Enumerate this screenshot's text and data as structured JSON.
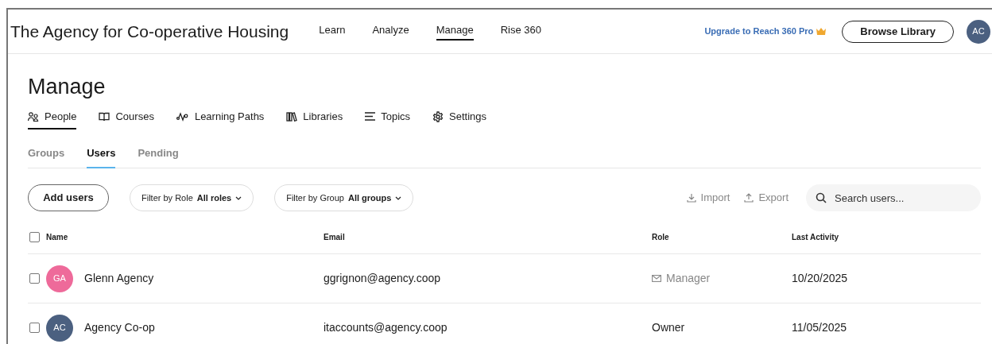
{
  "header": {
    "org_name": "The Agency for Co-operative Housing",
    "nav": [
      {
        "label": "Learn",
        "selected": false
      },
      {
        "label": "Analyze",
        "selected": false
      },
      {
        "label": "Manage",
        "selected": true
      },
      {
        "label": "Rise 360",
        "selected": false
      }
    ],
    "upgrade_link": "Upgrade to Reach 360 Pro",
    "browse_button": "Browse Library",
    "avatar": "AC"
  },
  "page_title": "Manage",
  "section_tabs": [
    {
      "label": "People",
      "kind": "people",
      "selected": true
    },
    {
      "label": "Courses",
      "kind": "courses",
      "selected": false
    },
    {
      "label": "Learning Paths",
      "kind": "paths",
      "selected": false
    },
    {
      "label": "Libraries",
      "kind": "libraries",
      "selected": false
    },
    {
      "label": "Topics",
      "kind": "topics",
      "selected": false
    },
    {
      "label": "Settings",
      "kind": "settings",
      "selected": false
    }
  ],
  "sub_tabs": [
    {
      "label": "Groups",
      "selected": false
    },
    {
      "label": "Users",
      "selected": true
    },
    {
      "label": "Pending",
      "selected": false
    }
  ],
  "toolbar": {
    "add_button": "Add users",
    "filters": [
      {
        "label": "Filter by Role",
        "value": "All roles"
      },
      {
        "label": "Filter by Group",
        "value": "All groups"
      }
    ],
    "import": "Import",
    "export": "Export",
    "search": {
      "placeholder": "Search users..."
    }
  },
  "table": {
    "columns": [
      "Name",
      "Email",
      "Role",
      "Last Activity"
    ],
    "select_all_checked": false,
    "rows": [
      {
        "checked": false,
        "initials": "GA",
        "color": "#ee6a9a",
        "name": "Glenn Agency",
        "email": "ggrignon@agency.coop",
        "role": "Manager",
        "invited": true,
        "last_activity": "10/20/2025"
      },
      {
        "checked": false,
        "initials": "AC",
        "color": "#4b6080",
        "name": "Agency Co-op",
        "email": "itaccounts@agency.coop",
        "role": "Owner",
        "invited": false,
        "last_activity": "11/05/2025"
      }
    ]
  }
}
